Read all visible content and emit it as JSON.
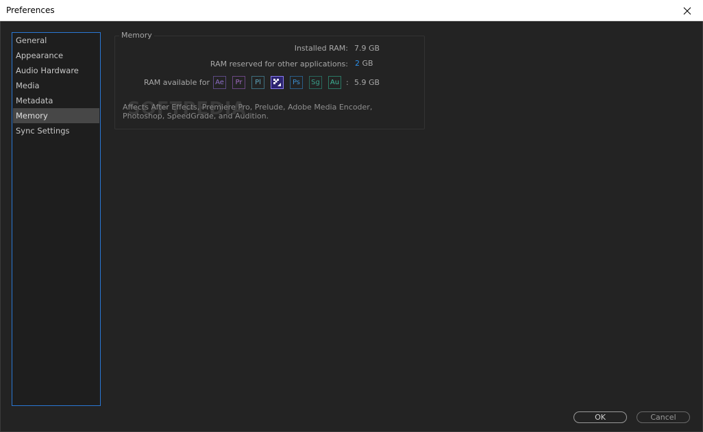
{
  "window": {
    "title": "Preferences"
  },
  "sidebar": {
    "items": [
      {
        "label": "General"
      },
      {
        "label": "Appearance"
      },
      {
        "label": "Audio Hardware"
      },
      {
        "label": "Media"
      },
      {
        "label": "Metadata"
      },
      {
        "label": "Memory",
        "selected": true
      },
      {
        "label": "Sync Settings"
      }
    ]
  },
  "memory": {
    "group_label": "Memory",
    "installed_label": "Installed RAM:",
    "installed_value": "7.9 GB",
    "reserved_label": "RAM reserved for other applications:",
    "reserved_value": "2",
    "reserved_unit": "GB",
    "available_label": "RAM available for",
    "available_sep": ":",
    "available_value": "5.9 GB",
    "apps": [
      {
        "abbr": "Ae",
        "color": "#8e6fc8",
        "border": "#5d4a84"
      },
      {
        "abbr": "Pr",
        "color": "#a36dc4",
        "border": "#6b4783"
      },
      {
        "abbr": "Pl",
        "color": "#5fa8c0",
        "border": "#3e6e7e"
      },
      {
        "abbr": "",
        "icon": "media-encoder-icon",
        "color": "#ffffff",
        "border": "#8a7cf0",
        "bg": "#2c2470"
      },
      {
        "abbr": "Ps",
        "color": "#3c8fd0",
        "border": "#2a5e88"
      },
      {
        "abbr": "Sg",
        "color": "#3aa08c",
        "border": "#28685c"
      },
      {
        "abbr": "Au",
        "color": "#3fb89a",
        "border": "#2a7864"
      }
    ],
    "description": "Affects After Effects, Premiere Pro, Prelude, Adobe Media Encoder, Photoshop, SpeedGrade, and Audition."
  },
  "watermark": "SOFTPEDIA",
  "footer": {
    "ok_label": "OK",
    "cancel_label": "Cancel"
  }
}
